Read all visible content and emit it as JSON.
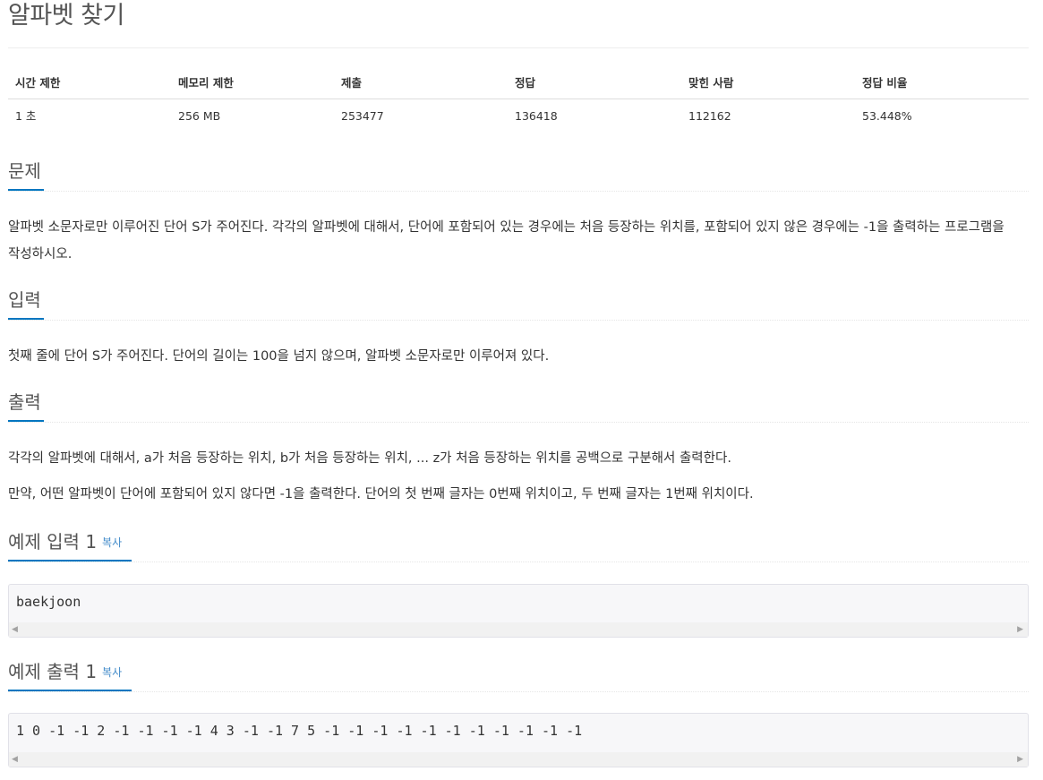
{
  "problem": {
    "title": "알파벳 찾기"
  },
  "info_table": {
    "headers": [
      "시간 제한",
      "메모리 제한",
      "제출",
      "정답",
      "맞힌 사람",
      "정답 비율"
    ],
    "values": [
      "1 초",
      "256 MB",
      "253477",
      "136418",
      "112162",
      "53.448%"
    ]
  },
  "sections": {
    "description": {
      "heading": "문제",
      "text": "알파벳 소문자로만 이루어진 단어 S가 주어진다. 각각의 알파벳에 대해서, 단어에 포함되어 있는 경우에는 처음 등장하는 위치를, 포함되어 있지 않은 경우에는 -1을 출력하는 프로그램을 작성하시오."
    },
    "input": {
      "heading": "입력",
      "text": "첫째 줄에 단어 S가 주어진다. 단어의 길이는 100을 넘지 않으며, 알파벳 소문자로만 이루어져 있다."
    },
    "output": {
      "heading": "출력",
      "text1": "각각의 알파벳에 대해서, a가 처음 등장하는 위치, b가 처음 등장하는 위치, ... z가 처음 등장하는 위치를 공백으로 구분해서 출력한다.",
      "text2": "만약, 어떤 알파벳이 단어에 포함되어 있지 않다면 -1을 출력한다. 단어의 첫 번째 글자는 0번째 위치이고, 두 번째 글자는 1번째 위치이다."
    },
    "sample_input": {
      "heading": "예제 입력 1",
      "copy_label": "복사",
      "content": "baekjoon"
    },
    "sample_output": {
      "heading": "예제 출력 1",
      "copy_label": "복사",
      "content": "1 0 -1 -1 2 -1 -1 -1 -1 4 3 -1 -1 7 5 -1 -1 -1 -1 -1 -1 -1 -1 -1 -1 -1"
    }
  },
  "icons": {
    "scroll_left": "scroll-left-arrow-icon",
    "scroll_right": "scroll-right-arrow-icon"
  },
  "colors": {
    "accent_underline": "#0076c0",
    "copy_link": "#428bca",
    "sample_background": "#f7f7f9"
  }
}
